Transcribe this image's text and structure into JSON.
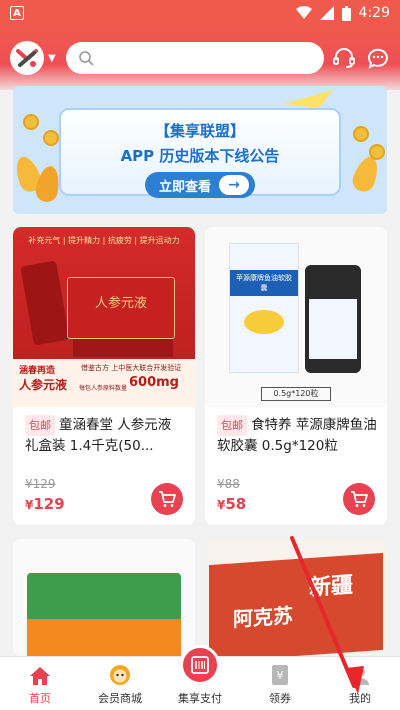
{
  "statusbar": {
    "time": "4:29",
    "app_indicator": "A"
  },
  "header": {
    "logo_icon": "app-logo-icon",
    "search_placeholder": "",
    "icons": [
      "headset-icon",
      "chat-bubble-icon"
    ]
  },
  "banner": {
    "title_line1": "【集享联盟】",
    "title_line2": "APP 历史版本下线公告",
    "button_label": "立即查看"
  },
  "products": [
    {
      "tag": "包邮",
      "title": "童涵春堂 人参元液 礼盒装 1.4千克(50...",
      "old_price": "¥129",
      "currency": "¥",
      "price": "129",
      "image_text": {
        "top_strip": "补充元气 | 提升精力 | 抗疲劳 | 提升运动力",
        "product_name": "人参元液",
        "brand_left": "涵春再造",
        "brand_left2": "人参元液",
        "slogan": "借鉴古方 上中医大联合开发验证",
        "volume": "600mg",
        "note": "每包人参原料数量"
      }
    },
    {
      "tag": "包邮",
      "title": "食特养 苹源康牌鱼油软胶囊 0.5g*120粒",
      "old_price": "¥88",
      "currency": "¥",
      "price": "58",
      "image_text": {
        "box_label": "苹源康牌鱼油软胶囊",
        "spec": "0.5g*120粒"
      }
    },
    {
      "image_text": {
        "box_text": "新疆",
        "product_name": "阿克苏"
      }
    },
    {
      "image_text": {}
    }
  ],
  "bottom_nav": [
    {
      "label": "首页",
      "icon": "home-icon",
      "active": true
    },
    {
      "label": "会员商城",
      "icon": "mascot-icon",
      "active": false
    },
    {
      "label": "集享支付",
      "icon": "scan-pay-icon",
      "active": false
    },
    {
      "label": "领券",
      "icon": "coupon-icon",
      "active": false
    },
    {
      "label": "我的",
      "icon": "profile-icon",
      "active": false
    }
  ],
  "colors": {
    "brand": "#e8414f",
    "header": "#f05a4d",
    "banner_bg": "#cfe6fa",
    "banner_blue": "#2d7fd3"
  }
}
